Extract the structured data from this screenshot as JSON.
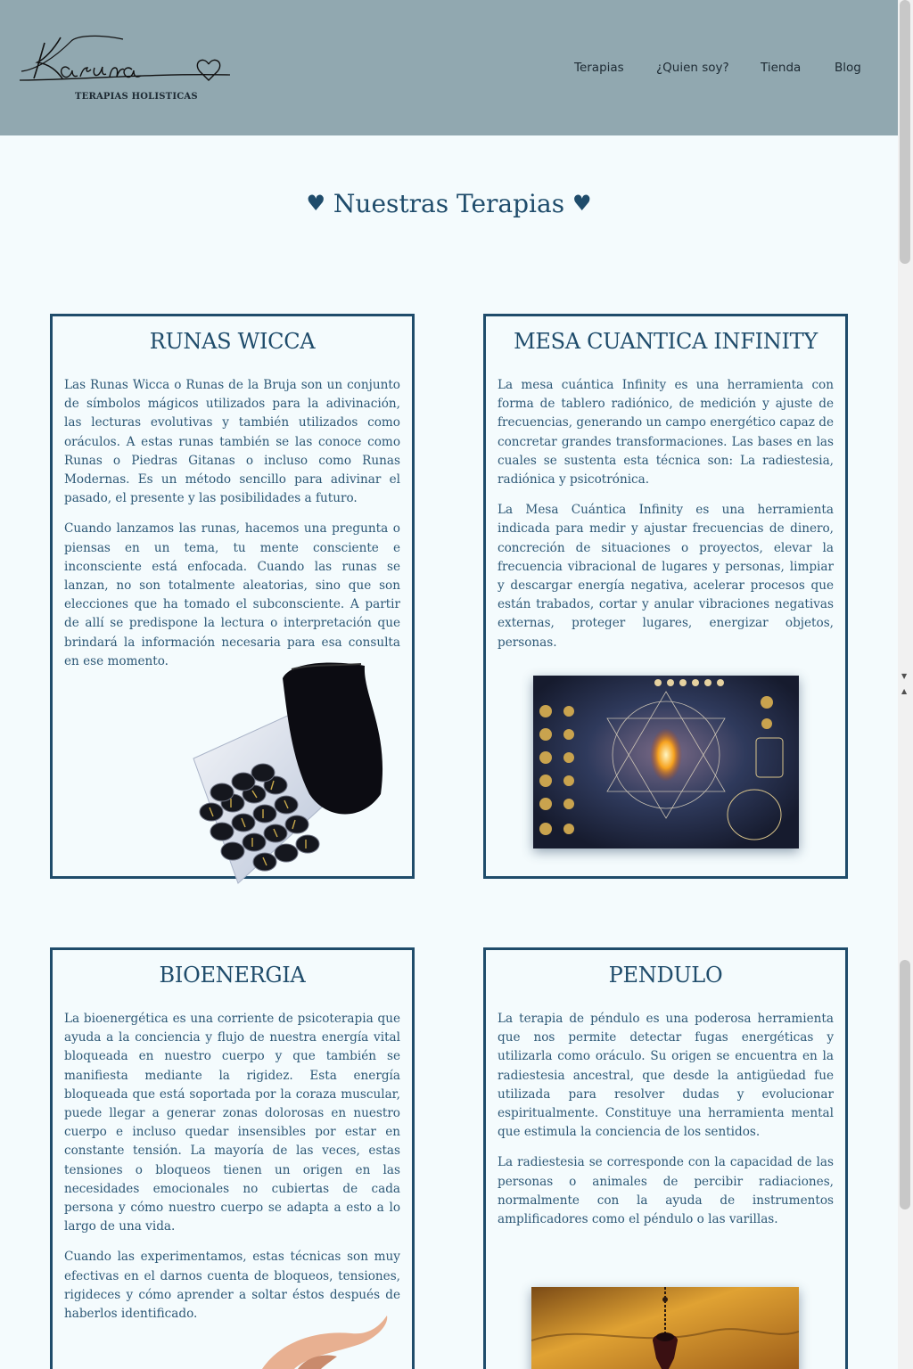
{
  "header": {
    "logo_script": "Karuna",
    "logo_subtitle": "TERAPIAS HOLISTICAS",
    "nav": [
      "Terapias",
      "¿Quien soy?",
      "Tienda",
      "Blog"
    ]
  },
  "section_title": "Nuestras Terapias",
  "cards": [
    {
      "title": "RUNAS WICCA",
      "paragraphs": [
        "Las Runas Wicca o Runas de la Bruja son un conjunto de símbolos mágicos utilizados para la adivinación, las lecturas evolutivas y también utilizados como oráculos. A estas runas también se las conoce como Runas o Piedras Gitanas o incluso como Runas Modernas. Es un método sencillo para adivinar el pasado, el presente y las posibilidades a futuro.",
        "Cuando lanzamos las runas, hacemos una pregunta o piensas en un tema, tu mente consciente e inconsciente está enfocada. Cuando las runas se lanzan, no son totalmente aleatorias, sino que son elecciones que ha tomado el subconsciente. A partir de allí se predispone la lectura o interpretación que brindará la información necesaria para esa consulta en ese momento."
      ]
    },
    {
      "title": "MESA CUANTICA INFINITY",
      "paragraphs": [
        "La mesa cuántica Infinity es una herramienta con forma de tablero radiónico, de medición y ajuste de frecuencias, generando un campo energético capaz de concretar grandes transformaciones. Las bases en las cuales se sustenta esta técnica son: La radiestesia, radiónica y psicotrónica.",
        "La Mesa Cuántica Infinity es una herramienta indicada para medir y ajustar frecuencias de dinero, concreción de situaciones o proyectos, elevar la frecuencia vibracional de lugares y personas, limpiar y descargar energía negativa, acelerar procesos que están trabados, cortar y anular vibraciones negativas externas, proteger lugares, energizar objetos, personas."
      ]
    },
    {
      "title": "BIOENERGIA",
      "paragraphs": [
        "La bioenergética es una corriente de psicoterapia que ayuda a la conciencia y flujo de nuestra energía vital bloqueada en nuestro cuerpo y que también se manifiesta mediante la rigidez. Esta energía bloqueada que está soportada por la coraza muscular, puede llegar a generar zonas dolorosas en nuestro cuerpo e incluso quedar insensibles por estar en constante tensión. La mayoría de las veces, estas tensiones o bloqueos tienen un origen en las necesidades emocionales no cubiertas de cada persona y cómo nuestro cuerpo se adapta a esto a lo largo de una vida.",
        "Cuando las experimentamos, estas técnicas son muy efectivas en el darnos cuenta de bloqueos, tensiones, rigideces y cómo aprender a soltar éstos después de haberlos identificado."
      ]
    },
    {
      "title": "PENDULO",
      "paragraphs": [
        "La terapia de péndulo es una poderosa herramienta que nos permite detectar fugas energéticas y utilizarla como oráculo. Su origen se encuentra en la radiestesia ancestral, que desde la antigüedad fue utilizada para resolver dudas y evolucionar espiritualmente. Constituye una herramienta mental que estimula la conciencia de los sentidos.",
        "La radiestesia se corresponde con la capacidad de las personas o animales de percibir radiaciones, normalmente con la ayuda de instrumentos amplificadores como el péndulo o las varillas."
      ]
    }
  ],
  "colors": {
    "header_bg": "#91a8b0",
    "page_bg": "#f4fbfd",
    "accent": "#1f4c6b"
  }
}
